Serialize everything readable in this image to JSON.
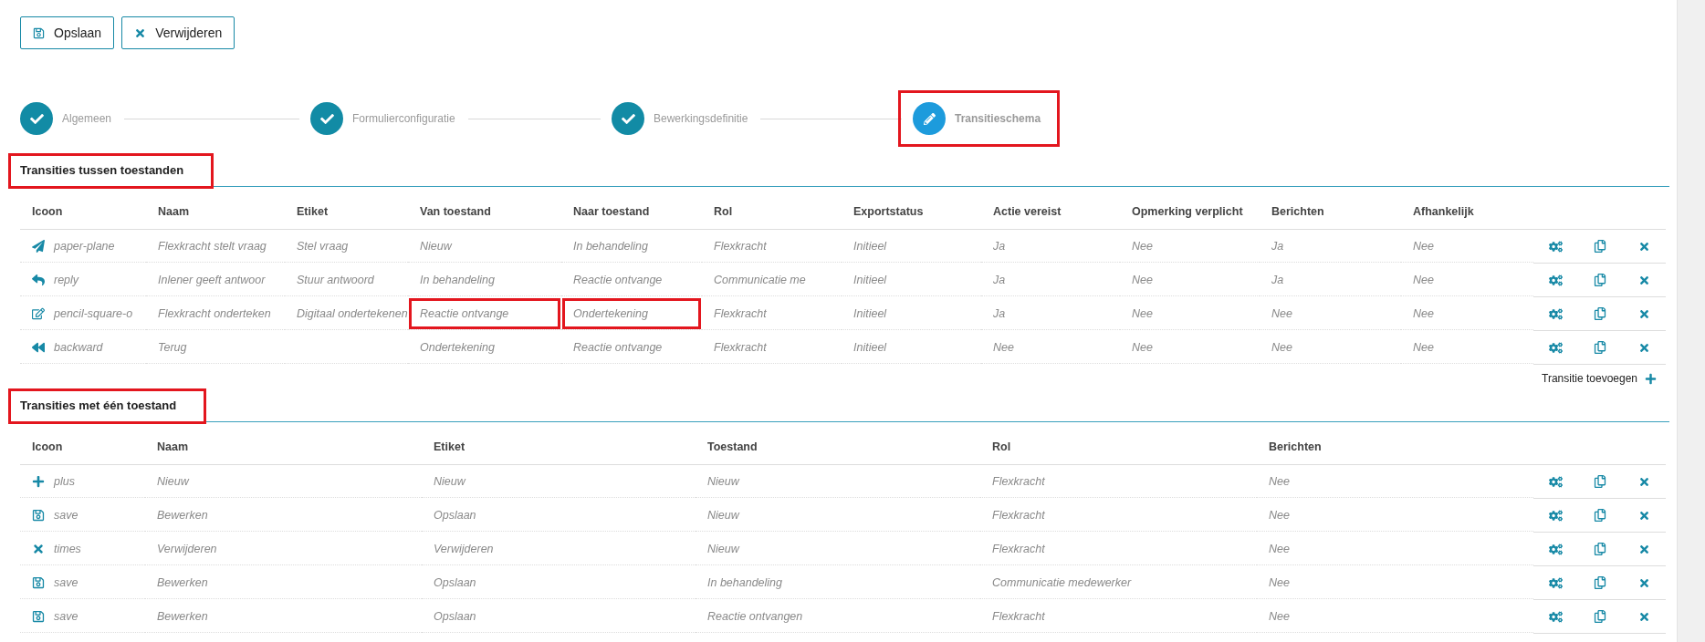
{
  "toolbar": [
    {
      "label": "Opslaan",
      "kind": "save"
    },
    {
      "label": "Verwijderen",
      "kind": "times"
    }
  ],
  "steps": [
    {
      "label": "Algemeen",
      "selected": false,
      "highlighted": false
    },
    {
      "label": "Formulierconfiguratie",
      "selected": false,
      "highlighted": false
    },
    {
      "label": "Bewerkingsdefinitie",
      "selected": false,
      "highlighted": false
    },
    {
      "label": "Transitieschema",
      "selected": true,
      "highlighted": true
    }
  ],
  "sections": [
    {
      "title": "Transities tussen toestanden",
      "highlighted": true,
      "columns": [
        "Icoon",
        "Naam",
        "Etiket",
        "Van toestand",
        "Naar toestand",
        "Rol",
        "Exportstatus",
        "Actie vereist",
        "Opmerking verplicht",
        "Berichten",
        "Afhankelijk"
      ],
      "rows": [
        {
          "kind": "send",
          "cells": [
            "paper-plane",
            "Flexkracht stelt vraag",
            "Stel vraag",
            "Nieuw",
            "In behandeling",
            "Flexkracht",
            "Initieel",
            "Ja",
            "Nee",
            "Ja",
            "Nee"
          ]
        },
        {
          "kind": "reply",
          "cells": [
            "reply",
            "Inlener geeft antwoor",
            "Stuur antwoord",
            "In behandeling",
            "Reactie ontvange",
            "Communicatie me",
            "Initieel",
            "Ja",
            "Nee",
            "Ja",
            "Nee"
          ]
        },
        {
          "kind": "edit",
          "cells": [
            "pencil-square-o",
            "Flexkracht onderteken",
            "Digitaal ondertekenen",
            {
              "text": "Reactie ontvange",
              "highlighted": true
            },
            {
              "text": "Ondertekening",
              "highlighted": true
            },
            "Flexkracht",
            "Initieel",
            "Ja",
            "Nee",
            "Nee",
            "Nee"
          ]
        },
        {
          "kind": "backward",
          "cells": [
            "backward",
            "Terug",
            "",
            "Ondertekening",
            "Reactie ontvange",
            "Flexkracht",
            "Initieel",
            "Nee",
            "Nee",
            "Nee",
            "Nee"
          ]
        }
      ],
      "add_label": "Transitie toevoegen"
    },
    {
      "title": "Transities met één toestand",
      "highlighted": true,
      "columns": [
        "Icoon",
        "Naam",
        "Etiket",
        "Toestand",
        "Rol",
        "Berichten"
      ],
      "rows": [
        {
          "kind": "plus",
          "cells": [
            "plus",
            "Nieuw",
            "Nieuw",
            "Nieuw",
            "Flexkracht",
            "Nee"
          ]
        },
        {
          "kind": "save",
          "cells": [
            "save",
            "Bewerken",
            "Opslaan",
            "Nieuw",
            "Flexkracht",
            "Nee"
          ]
        },
        {
          "kind": "times",
          "cells": [
            "times",
            "Verwijderen",
            "Verwijderen",
            "Nieuw",
            "Flexkracht",
            "Nee"
          ]
        },
        {
          "kind": "save",
          "cells": [
            "save",
            "Bewerken",
            "Opslaan",
            "In behandeling",
            "Communicatie medewerker",
            "Nee"
          ]
        },
        {
          "kind": "save",
          "cells": [
            "save",
            "Bewerken",
            "Opslaan",
            "Reactie ontvangen",
            "Flexkracht",
            "Nee"
          ]
        }
      ]
    }
  ]
}
